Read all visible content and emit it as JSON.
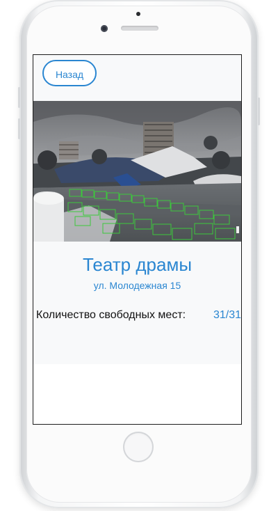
{
  "header": {
    "back_label": "Назад"
  },
  "venue": {
    "title": "Театр драмы",
    "address": "ул. Молодежная 15"
  },
  "parking": {
    "free_label": "Количество свободных мест:",
    "free_value": "31/31"
  },
  "colors": {
    "accent": "#2a86d1",
    "text": "#111111",
    "detection_box": "#3cc93c"
  },
  "icons": {
    "camera_feed": "parking-camera-image"
  }
}
